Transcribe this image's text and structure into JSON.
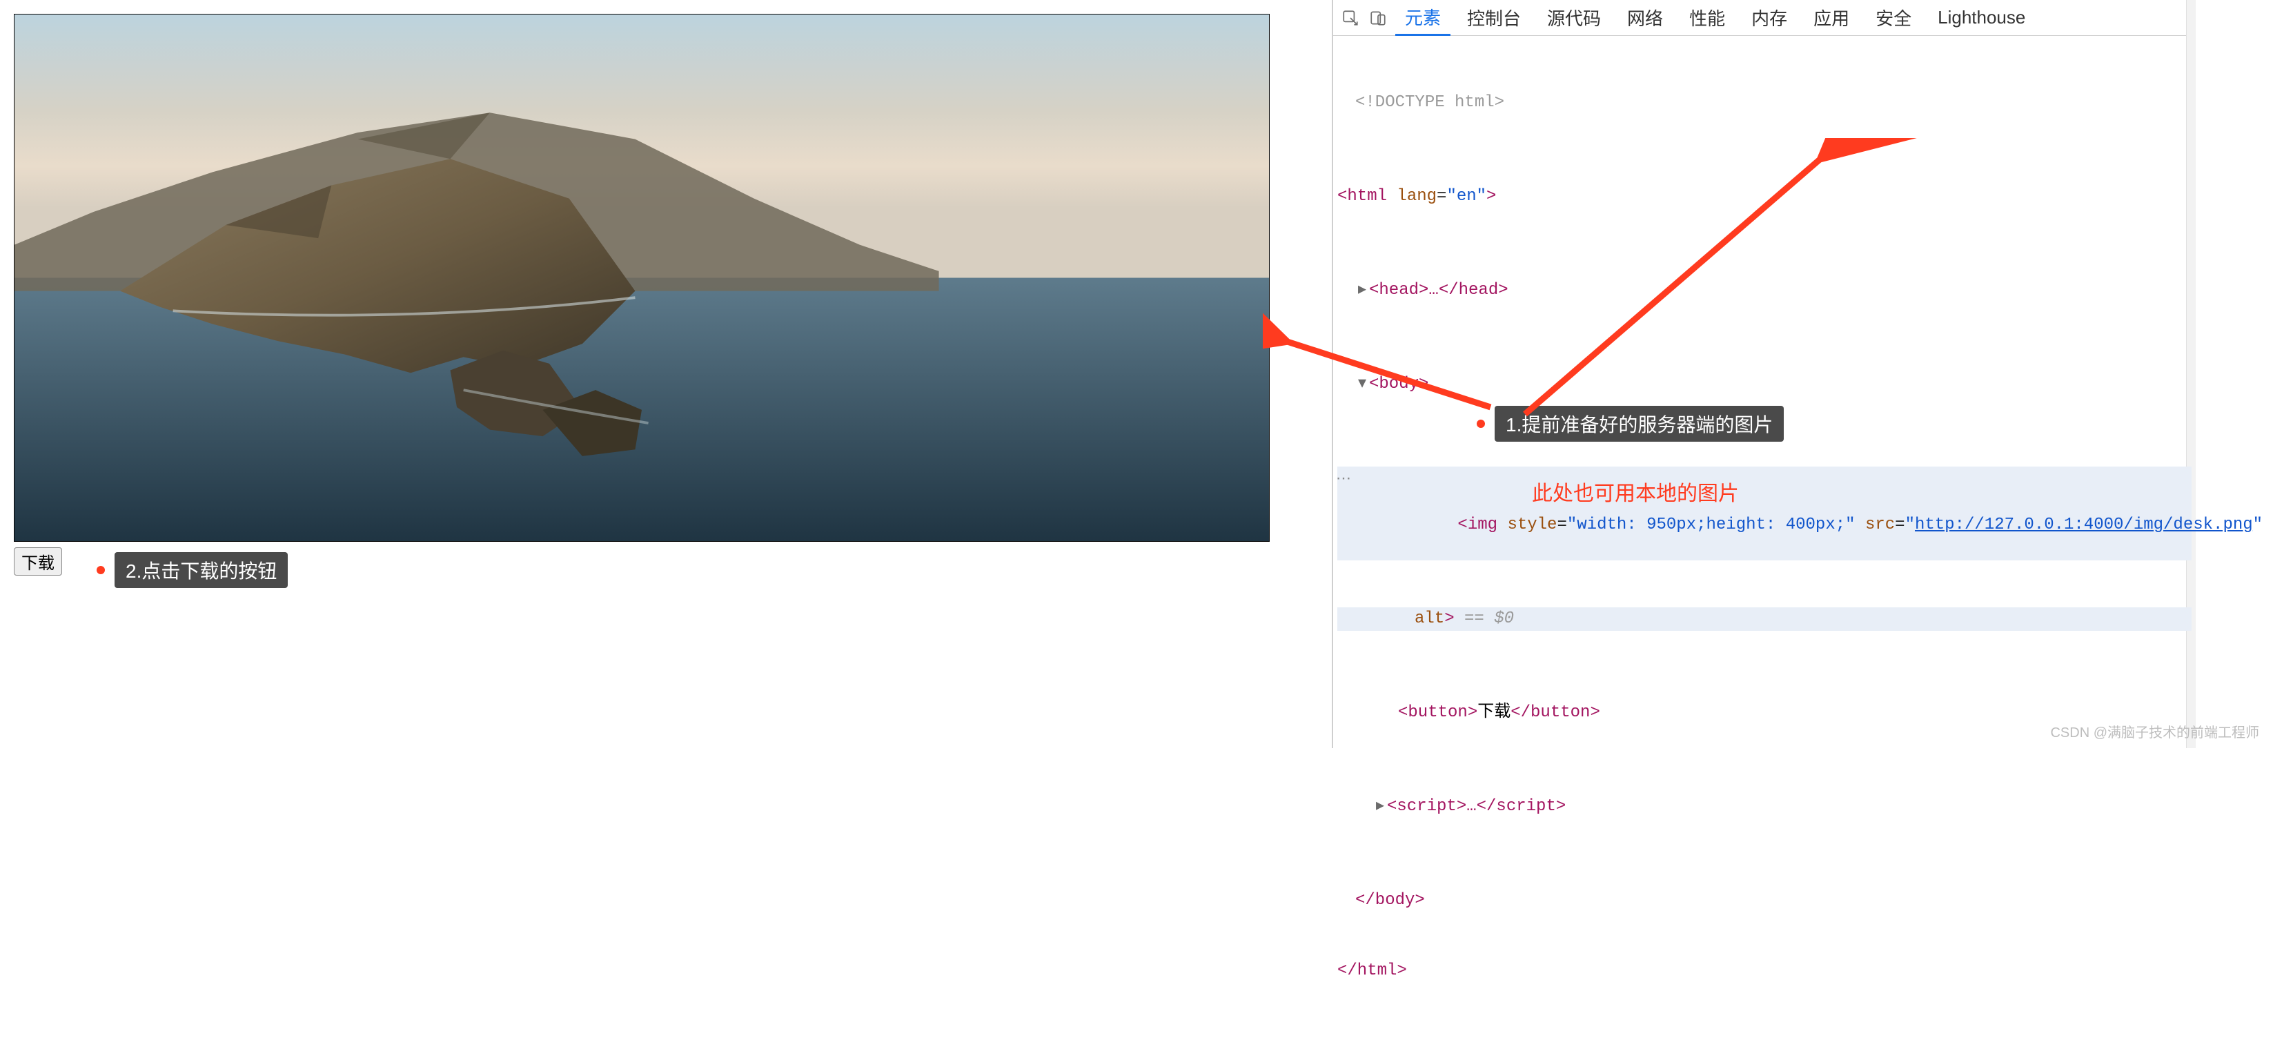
{
  "page": {
    "download_button": "下载"
  },
  "annotations": {
    "step1": "1.提前准备好的服务器端的图片",
    "step2": "2.点击下载的按钮",
    "note": "此处也可用本地的图片"
  },
  "devtools": {
    "tabs": [
      "元素",
      "控制台",
      "源代码",
      "网络",
      "性能",
      "内存",
      "应用",
      "安全",
      "Lighthouse"
    ],
    "active_tab_index": 0,
    "dom": {
      "doctype": "<!DOCTYPE html>",
      "html_open": "<html ",
      "html_lang_attr": "lang",
      "html_lang_val": "\"en\"",
      "html_open_end": ">",
      "head": "<head>…</head>",
      "body_open": "<body>",
      "img_open": "<img ",
      "img_style_attr": "style",
      "img_style_val": "\"width: 950px;height: 400px;\"",
      "img_src_attr": "src",
      "img_src_val": "http://127.0.0.1:4000/img/desk.png",
      "img_alt_attr": "alt",
      "img_alt_close": ">",
      "selected_suffix": " == $0",
      "button_open": "<button>",
      "button_text": "下载",
      "button_close": "</button>",
      "script": "<script>…</scr",
      "script2": "ipt>",
      "body_close": "</body>",
      "html_close": "</html>"
    }
  },
  "watermark": "CSDN @满脑子技术的前端工程师"
}
